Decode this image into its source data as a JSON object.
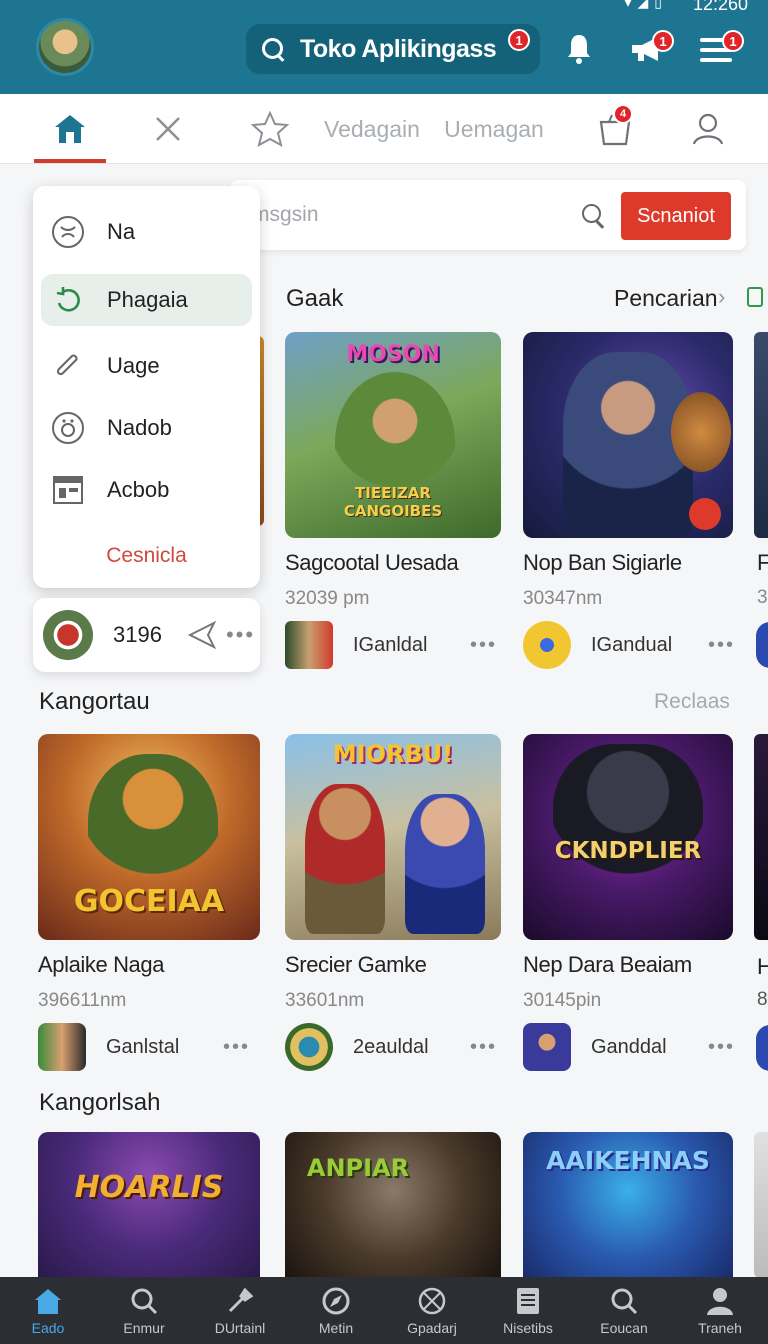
{
  "status": {
    "time": "12:260"
  },
  "header": {
    "search_title": "Toko Aplikingass",
    "badges": {
      "search": "1",
      "megaphone": "1",
      "menu": "1"
    }
  },
  "nav": {
    "tabs": [
      {
        "label": "Vedagain"
      },
      {
        "label": "Uemagan"
      }
    ],
    "cart_badge": "4"
  },
  "search": {
    "placeholder": "msgsin",
    "button": "Scnaniot"
  },
  "menu": {
    "items": [
      {
        "label": "Na",
        "icon": "circle-wave-icon"
      },
      {
        "label": "Phagaia",
        "icon": "refresh-icon"
      },
      {
        "label": "Uage",
        "icon": "paperclip-icon"
      },
      {
        "label": "Nadob",
        "icon": "face-circle-icon"
      },
      {
        "label": "Acbob",
        "icon": "layout-icon"
      }
    ],
    "cancel": "Cesnicla"
  },
  "share_card": {
    "count": "3196",
    "dots": "•••"
  },
  "sections": [
    {
      "title": "Gaak",
      "link": "Pencarian"
    },
    {
      "title": "Kangortau",
      "link": "Reclaas"
    },
    {
      "title": "Kangorlsah"
    }
  ],
  "row1": [
    {
      "title": "Sagcootal Uesada",
      "meta": "32039 pm",
      "dev": "IGanldal",
      "art": "MOSON",
      "art2": "TIEEIZAR CANGOIBES"
    },
    {
      "title": "Nop Ban Sigiarle",
      "meta": "30347nm",
      "dev": "IGandual"
    }
  ],
  "row1_edge": {
    "title": "F",
    "meta": "3"
  },
  "row2": [
    {
      "title": "Aplaike Naga",
      "meta": "396611nm",
      "dev": "Ganlstal",
      "art": "GOCEIAA"
    },
    {
      "title": "Srecier Gamke",
      "meta": "33601nm",
      "dev": "2eauldal",
      "art": "MIORBU!"
    },
    {
      "title": "Nep Dara Beaiam",
      "meta": "30145pin",
      "dev": "Ganddal",
      "art": "CKNDPLIER"
    }
  ],
  "row2_edge": {
    "title": "H",
    "meta": "8"
  },
  "row3": [
    {
      "art": "HOARLIS"
    },
    {
      "art": "ANPIAR"
    },
    {
      "art": "AAIKEHNAS"
    }
  ],
  "bottom_nav": [
    {
      "label": "Eado",
      "icon": "home-icon"
    },
    {
      "label": "Enmur",
      "icon": "search-icon"
    },
    {
      "label": "DUrtainl",
      "icon": "tools-icon"
    },
    {
      "label": "Metin",
      "icon": "compass-icon"
    },
    {
      "label": "Gpadarj",
      "icon": "globe-icon"
    },
    {
      "label": "Nisetibs",
      "icon": "document-icon"
    },
    {
      "label": "Eoucan",
      "icon": "search-icon"
    },
    {
      "label": "Traneh",
      "icon": "user-icon"
    }
  ],
  "colors": {
    "header": "#1d7591",
    "accent": "#dd3a2c",
    "active_nav": "#4aa8e8"
  }
}
